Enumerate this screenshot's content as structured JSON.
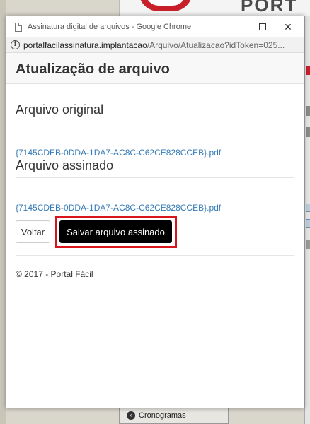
{
  "background": {
    "logo_text": "PORT",
    "bottom_tab_label": "Cronogramas",
    "bottom_tab_icon": "double-chevron-right-icon"
  },
  "window": {
    "title": "Assinatura digital de arquivos - Google Chrome",
    "url_host": "portalfacilassinatura.implantacao",
    "url_path": "/Arquivo/Atualizacao?idToken=025..."
  },
  "page": {
    "heading": "Atualização de arquivo",
    "original_section_title": "Arquivo original",
    "original_file": "{7145CDEB-0DDA-1DA7-AC8C-C62CE828CCEB}.pdf",
    "signed_section_title": "Arquivo assinado",
    "signed_file": "{7145CDEB-0DDA-1DA7-AC8C-C62CE828CCEB}.pdf",
    "back_label": "Voltar",
    "save_label": "Salvar arquivo assinado",
    "footer": "© 2017 - Portal Fácil"
  },
  "colors": {
    "link": "#337ab7",
    "highlight": "#d9141b",
    "primary_button": "#000000"
  }
}
